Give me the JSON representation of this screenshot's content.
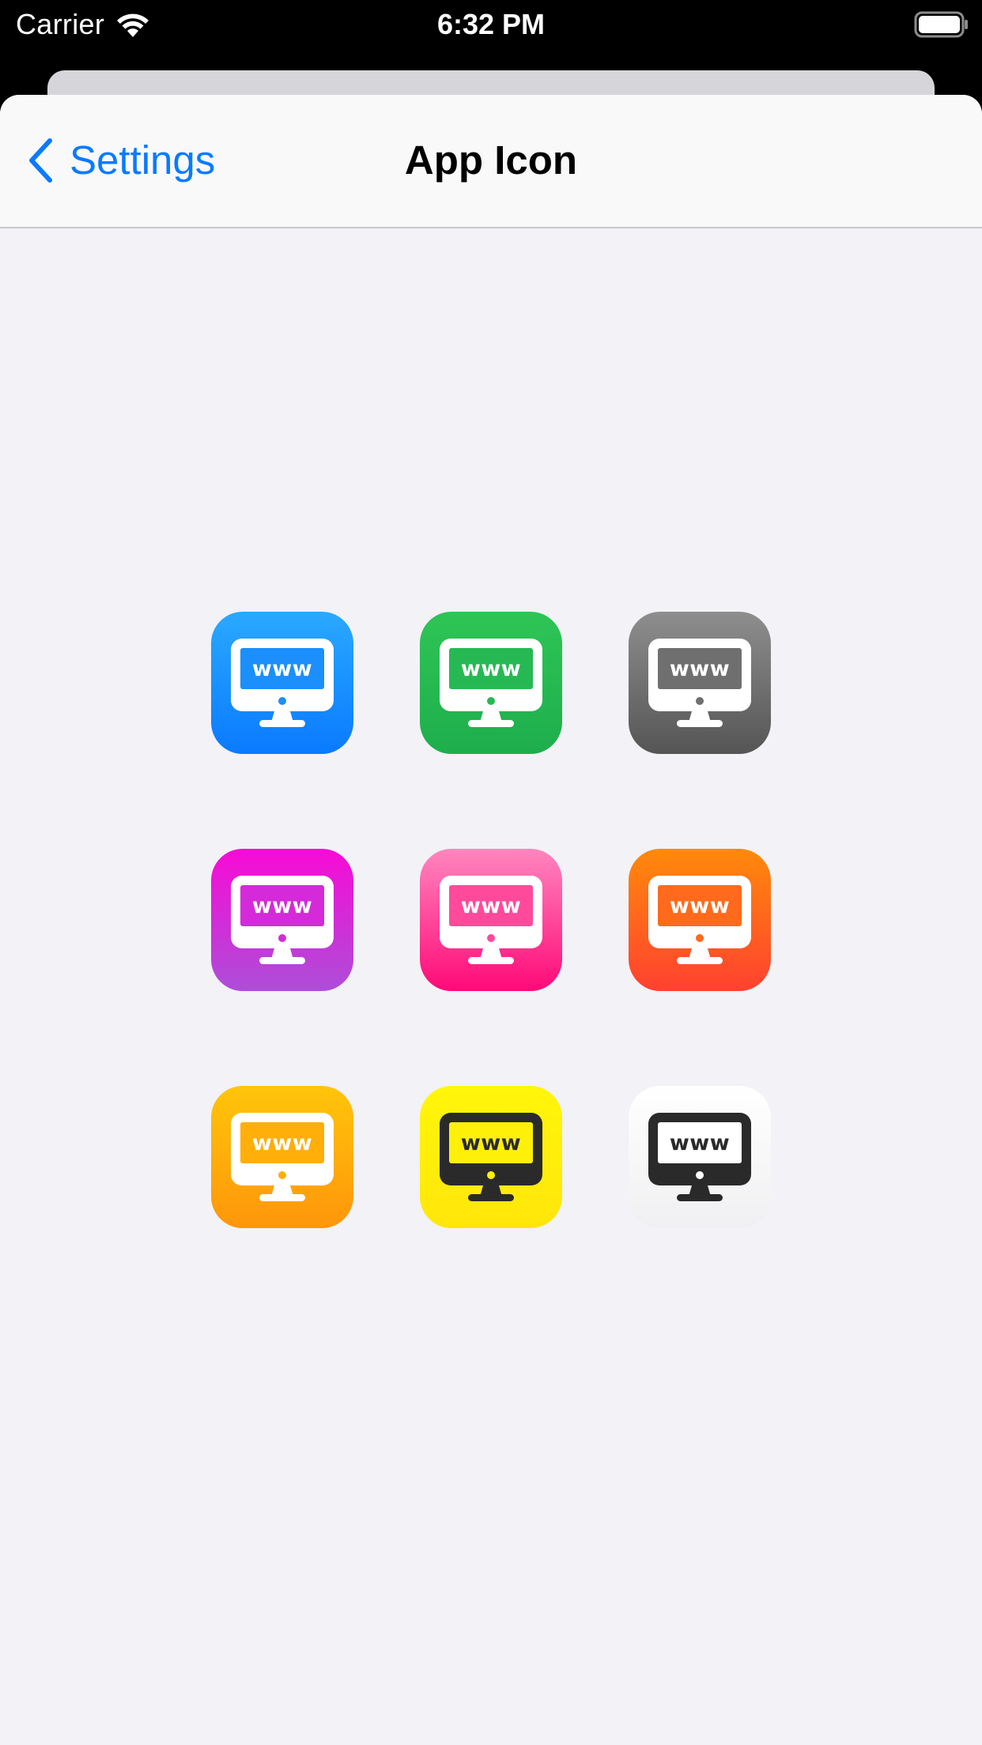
{
  "status_bar": {
    "carrier": "Carrier",
    "time": "6:32 PM"
  },
  "nav": {
    "back_label": "Settings",
    "title": "App Icon"
  },
  "icons": [
    {
      "text": "www",
      "bg_top": "#2aa9ff",
      "bg_bottom": "#0a7aff",
      "monitor": "#ffffff",
      "screen": "#1b8ffc",
      "text_color": "#ffffff",
      "dot": "#1b8ffc"
    },
    {
      "text": "www",
      "bg_top": "#2ec556",
      "bg_bottom": "#1eae4c",
      "monitor": "#ffffff",
      "screen": "#26b953",
      "text_color": "#ffffff",
      "dot": "#26b953"
    },
    {
      "text": "www",
      "bg_top": "#8e8e8e",
      "bg_bottom": "#555555",
      "monitor": "#ffffff",
      "screen": "#6f6f6f",
      "text_color": "#ffffff",
      "dot": "#6f6f6f"
    },
    {
      "text": "www",
      "bg_top": "#f80ad6",
      "bg_bottom": "#ad4ed8",
      "monitor": "#ffffff",
      "screen": "#d52ad9",
      "text_color": "#ffffff",
      "dot": "#d52ad9"
    },
    {
      "text": "www",
      "bg_top": "#ff86be",
      "bg_bottom": "#ff0a78",
      "monitor": "#ffffff",
      "screen": "#ff4a9c",
      "text_color": "#ffffff",
      "dot": "#ff4a9c"
    },
    {
      "text": "www",
      "bg_top": "#ff8a0a",
      "bg_bottom": "#ff4130",
      "monitor": "#ffffff",
      "screen": "#ff6a1c",
      "text_color": "#ffffff",
      "dot": "#ff6a1c"
    },
    {
      "text": "www",
      "bg_top": "#ffc50a",
      "bg_bottom": "#ff960a",
      "monitor": "#ffffff",
      "screen": "#ffae0a",
      "text_color": "#ffffff",
      "dot": "#ffae0a"
    },
    {
      "text": "www",
      "bg_top": "#fff60a",
      "bg_bottom": "#ffe60a",
      "monitor": "#2a2a2a",
      "screen": "#fff00a",
      "text_color": "#2a2a2a",
      "dot": "#fff00a"
    },
    {
      "text": "www",
      "bg_top": "#ffffff",
      "bg_bottom": "#f0f0f2",
      "monitor": "#2a2a2a",
      "screen": "#ffffff",
      "text_color": "#2a2a2a",
      "dot": "#ffffff"
    }
  ],
  "colors": {
    "accent": "#0a7aff",
    "background": "#f2f2f7",
    "nav_background": "#f9f9fa"
  }
}
